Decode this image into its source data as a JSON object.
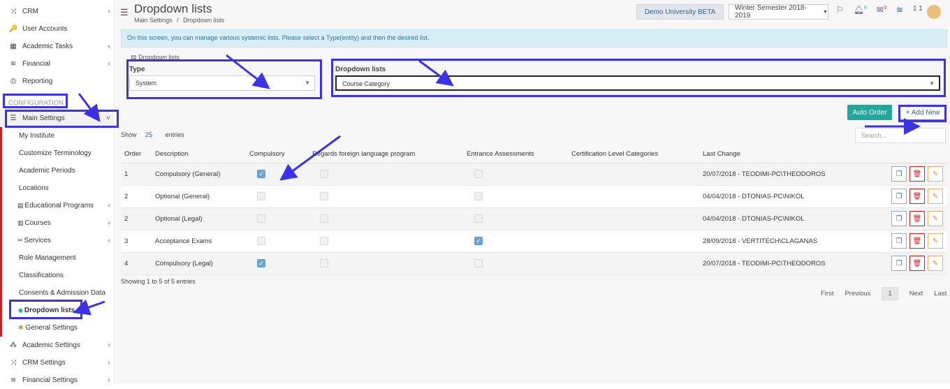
{
  "sidebar": {
    "items": [
      {
        "label": "CRM",
        "icon": "shuffle-icon",
        "chevron": "‹"
      },
      {
        "label": "User Accounts",
        "icon": "key-icon",
        "chevron": ""
      },
      {
        "label": "Academic Tasks",
        "icon": "grid-icon",
        "chevron": "‹"
      },
      {
        "label": "Financial",
        "icon": "coins-icon",
        "chevron": "‹"
      },
      {
        "label": "Reporting",
        "icon": "printer-icon",
        "chevron": ""
      }
    ],
    "section_label": "CONFIGURATION",
    "main_settings": {
      "label": "Main Settings",
      "icon": "sliders-icon",
      "chevron": "˅"
    },
    "sub_items": [
      {
        "label": "My Institute",
        "icon": "",
        "chevron": ""
      },
      {
        "label": "Customize Terminology",
        "icon": "",
        "chevron": ""
      },
      {
        "label": "Academic Periods",
        "icon": "",
        "chevron": ""
      },
      {
        "label": "Locations",
        "icon": "",
        "chevron": ""
      },
      {
        "label": "Educational Programs",
        "icon": "list-icon",
        "chevron": "‹"
      },
      {
        "label": "Courses",
        "icon": "book-icon",
        "chevron": "‹"
      },
      {
        "label": "Services",
        "icon": "tools-icon",
        "chevron": "‹"
      },
      {
        "label": "Role Management",
        "icon": "",
        "chevron": ""
      },
      {
        "label": "Classifications",
        "icon": "",
        "chevron": ""
      },
      {
        "label": "Consents & Admission Data",
        "icon": "",
        "chevron": ""
      },
      {
        "label": "Dropdown lists",
        "icon": "layers-icon",
        "chevron": ""
      },
      {
        "label": "General Settings",
        "icon": "cog-icon",
        "chevron": ""
      }
    ],
    "bottom_items": [
      {
        "label": "Academic Settings",
        "icon": "org-icon",
        "chevron": "‹"
      },
      {
        "label": "CRM Settings",
        "icon": "shuffle-icon",
        "chevron": "‹"
      },
      {
        "label": "Financial Settings",
        "icon": "coins-icon",
        "chevron": "‹"
      }
    ]
  },
  "header": {
    "title": "Dropdown lists",
    "breadcrumb_1": "Main Settings",
    "breadcrumb_sep": "/",
    "breadcrumb_2": "Dropdown lists",
    "institution": "Demo University BETA",
    "semester": "Winter Semester 2018-2019",
    "notif_count": "6",
    "mail_count": "3",
    "user_count": "1 1"
  },
  "info": "On this screen, you can manage various systemic lists. Please select a Type(entity) and then the desired list.",
  "filter": {
    "section_title": "Dropdown lists",
    "type_label": "Type",
    "type_value": "System",
    "list_label": "Dropdown lists",
    "list_value": "Course Category"
  },
  "buttons": {
    "auto_order": "Auto Order",
    "add_new": "+ Add New"
  },
  "show": {
    "prefix": "Show",
    "value": "25",
    "suffix": "entries"
  },
  "search_placeholder": "Search...",
  "table": {
    "headers": [
      "Order",
      "Description",
      "Compulsory",
      "Regards foreign language program",
      "Entrance Assessments",
      "Certification Level Categories",
      "Last Change",
      ""
    ],
    "rows": [
      {
        "order": "1",
        "desc": "Compulsory (General)",
        "compulsory": true,
        "foreign": false,
        "entrance": false,
        "cert": "",
        "change": "20/07/2018 - TEODIMI-PC\\THEODOROS"
      },
      {
        "order": "2",
        "desc": "Optional (General)",
        "compulsory": false,
        "foreign": false,
        "entrance": false,
        "cert": "",
        "change": "04/04/2018 - DTONIAS-PC\\NIKOL"
      },
      {
        "order": "2",
        "desc": "Optional (Legal)",
        "compulsory": false,
        "foreign": false,
        "entrance": false,
        "cert": "",
        "change": "04/04/2018 - DTONIAS-PC\\NIKOL"
      },
      {
        "order": "3",
        "desc": "Acceptance Exams",
        "compulsory": false,
        "foreign": false,
        "entrance": true,
        "cert": "",
        "change": "28/09/2018 - VERTITECH\\CLAGANAS"
      },
      {
        "order": "4",
        "desc": "Compulsory (Legal)",
        "compulsory": true,
        "foreign": false,
        "entrance": false,
        "cert": "",
        "change": "20/07/2018 - TEODIMI-PC\\THEODOROS"
      }
    ]
  },
  "footer": "Showing 1 to 5 of 5 entries",
  "pager": {
    "first": "First",
    "previous": "Previous",
    "current": "1",
    "next": "Next",
    "last": "Last"
  },
  "colors": {
    "accent": "#c4232c",
    "highlight": "#3b32e8",
    "green": "#26a69a",
    "check": "#6aa6d8"
  }
}
